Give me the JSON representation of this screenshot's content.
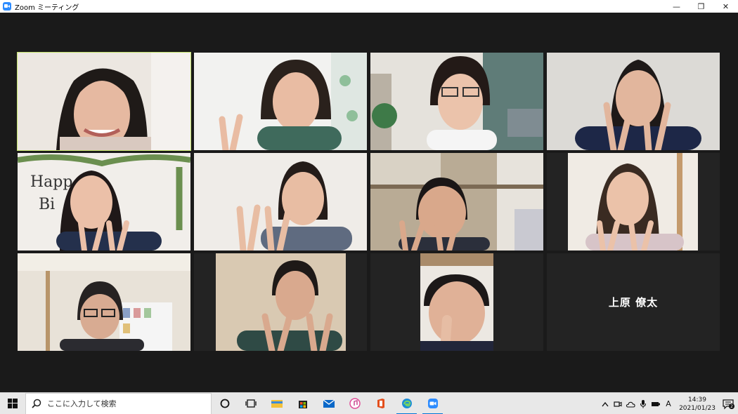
{
  "window": {
    "title": "Zoom ミーティング",
    "minimize_glyph": "—",
    "restore_glyph": "❐",
    "close_glyph": "✕"
  },
  "gallery": {
    "active_border_color": "#c4e36a",
    "participants": [
      {
        "id": "p1",
        "active": true
      },
      {
        "id": "p2"
      },
      {
        "id": "p3"
      },
      {
        "id": "p4"
      },
      {
        "id": "p5"
      },
      {
        "id": "p6"
      },
      {
        "id": "p7"
      },
      {
        "id": "p8"
      },
      {
        "id": "p9"
      },
      {
        "id": "p10"
      },
      {
        "id": "p11"
      },
      {
        "id": "p12",
        "name": "上原 僚太",
        "video": false
      }
    ]
  },
  "taskbar": {
    "search_placeholder": "ここに入力して検索",
    "apps": [
      "task-view-icon",
      "file-explorer-icon",
      "store-icon",
      "mail-icon",
      "itunes-icon",
      "office-icon",
      "edge-icon",
      "zoom-icon"
    ],
    "tray": {
      "ime_indicator": "A",
      "time": "14:39",
      "date": "2021/01/23",
      "notification_count": "2"
    }
  }
}
